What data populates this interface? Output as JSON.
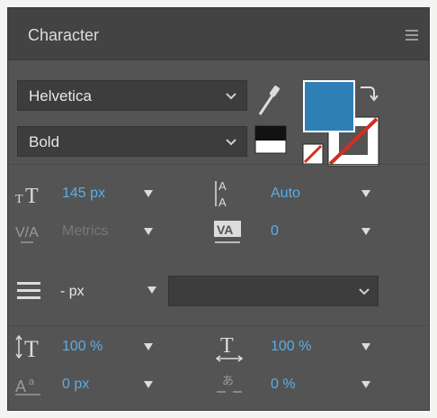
{
  "panel": {
    "title": "Character"
  },
  "font": {
    "family": "Helvetica",
    "style": "Bold"
  },
  "colors": {
    "fill": "#2f7fb7",
    "panel_bg": "#545454",
    "value_blue": "#5aaee6",
    "none_red": "#d32f1f"
  },
  "metrics": {
    "font_size": "145 px",
    "leading": "Auto",
    "kerning": "Metrics",
    "tracking": "0"
  },
  "paragraph": {
    "indent": "- px",
    "style_value": ""
  },
  "scale": {
    "vertical": "100 %",
    "horizontal": "100 %",
    "baseline_shift": "0 px",
    "tsume": "0 %"
  },
  "icons": {
    "menu": "hamburger-menu-icon",
    "eyedropper": "eyedropper-icon",
    "swap": "swap-colors-icon"
  }
}
